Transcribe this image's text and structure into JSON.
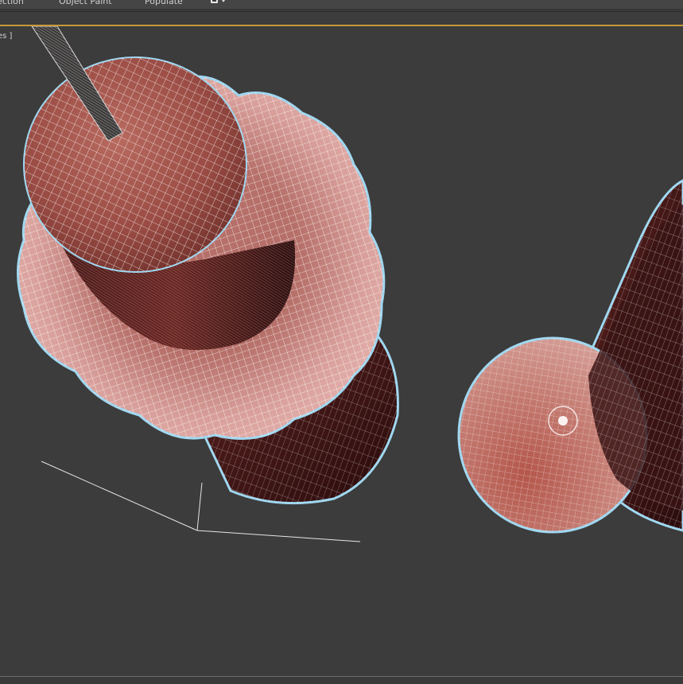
{
  "ribbon": {
    "tabs": [
      {
        "label": "ection"
      },
      {
        "label": "Object Paint"
      },
      {
        "label": "Populate"
      }
    ],
    "icon": "display-options-icon"
  },
  "viewport": {
    "label": "es ]",
    "view": "perspective",
    "shading": "default shading + edged faces",
    "active_border_color": "#c69a3a",
    "background_color": "#3c3c3c",
    "wire_color": "#ffffff",
    "selection_outline_color": "#9fd7f0",
    "material_colors": [
      "#a9554c",
      "#3a1515",
      "#d9a09b"
    ]
  }
}
